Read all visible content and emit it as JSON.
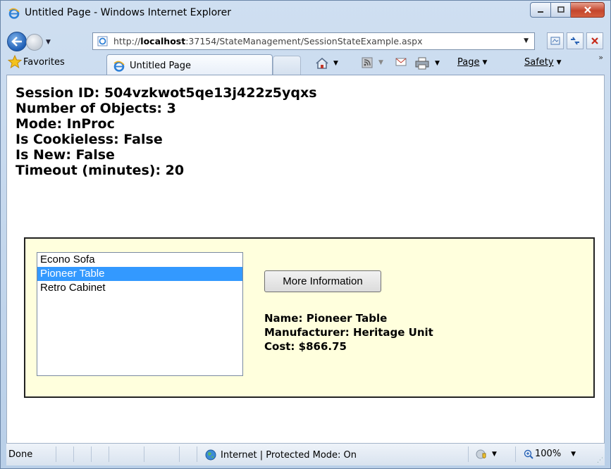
{
  "window": {
    "title": "Untitled Page - Windows Internet Explorer"
  },
  "address": {
    "url_prefix": "http://",
    "url_host": "localhost",
    "url_rest": ":37154/StateManagement/SessionStateExample.aspx"
  },
  "favorites_bar": {
    "favorites_label": "Favorites",
    "tab_label": "Untitled Page",
    "page_menu": "Page",
    "safety_menu": "Safety"
  },
  "session_info": {
    "session_id": "Session ID: 504vzkwot5qe13j422z5yqxs",
    "num_objects": "Number of Objects: 3",
    "mode": "Mode: InProc",
    "cookieless": "Is Cookieless: False",
    "is_new": "Is New: False",
    "timeout": "Timeout (minutes): 20"
  },
  "products": {
    "items": [
      "Econo Sofa",
      "Pioneer Table",
      "Retro Cabinet"
    ],
    "selected": "Pioneer Table",
    "button_label": "More Information",
    "details": {
      "name": "Name: Pioneer Table",
      "manufacturer": "Manufacturer: Heritage Unit",
      "cost": "Cost: $866.75"
    }
  },
  "status_bar": {
    "status": "Done",
    "zone": "Internet | Protected Mode: On",
    "zoom": "100%"
  },
  "colors": {
    "selection": "#3399ff",
    "panel_background": "#ffffdd"
  }
}
